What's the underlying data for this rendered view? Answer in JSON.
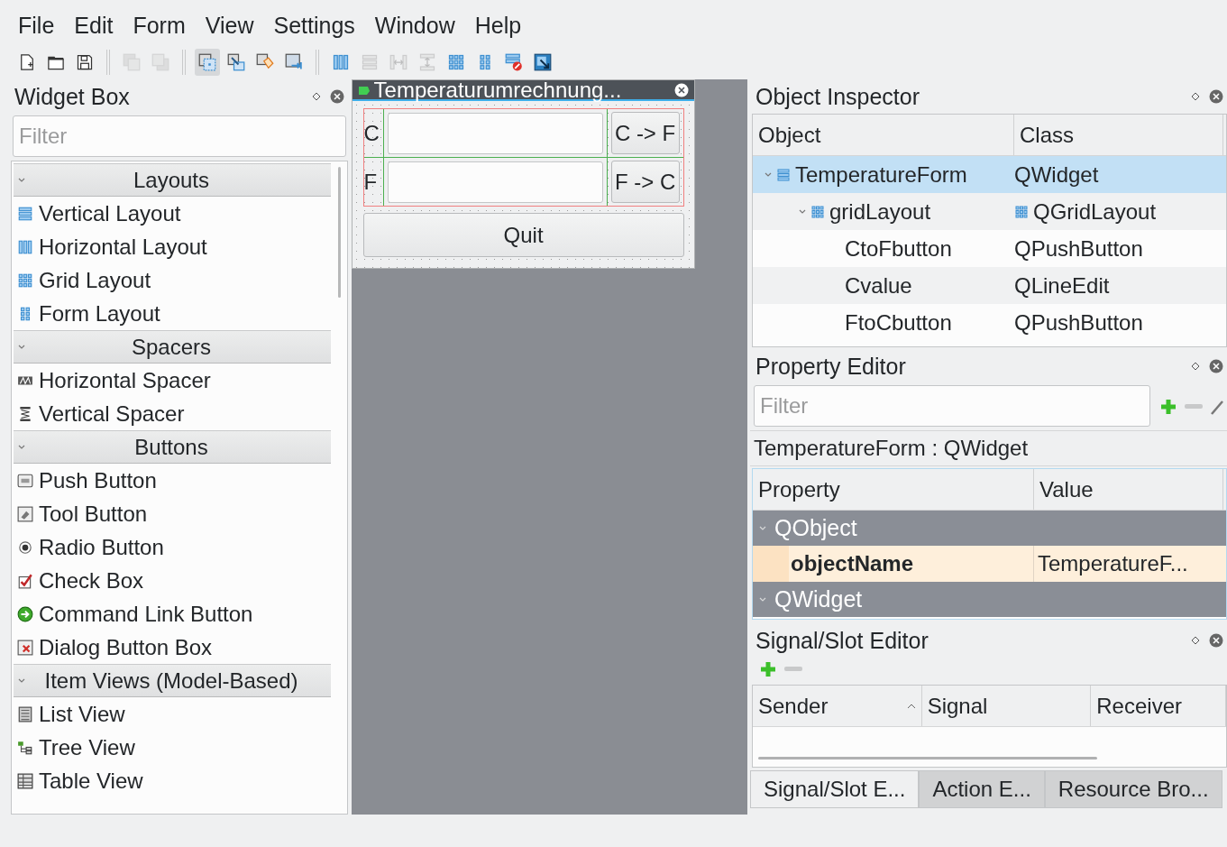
{
  "menu": [
    "File",
    "Edit",
    "Form",
    "View",
    "Settings",
    "Window",
    "Help"
  ],
  "toolbar": [
    {
      "kind": "new",
      "disabled": false,
      "selected": false
    },
    {
      "kind": "open",
      "disabled": false,
      "selected": false
    },
    {
      "kind": "save",
      "disabled": false,
      "selected": false
    },
    {
      "kind": "separator"
    },
    {
      "kind": "send-back",
      "disabled": true,
      "selected": false
    },
    {
      "kind": "bring-front",
      "disabled": true,
      "selected": false
    },
    {
      "kind": "separator"
    },
    {
      "kind": "edit-widgets",
      "disabled": false,
      "selected": true
    },
    {
      "kind": "edit-signals",
      "disabled": false,
      "selected": false
    },
    {
      "kind": "edit-buddies",
      "disabled": false,
      "selected": false
    },
    {
      "kind": "edit-tab-order",
      "disabled": false,
      "selected": false
    },
    {
      "kind": "separator"
    },
    {
      "kind": "layout-h",
      "disabled": false,
      "selected": false
    },
    {
      "kind": "layout-v",
      "disabled": true,
      "selected": false
    },
    {
      "kind": "split-h",
      "disabled": true,
      "selected": false
    },
    {
      "kind": "split-v",
      "disabled": true,
      "selected": false
    },
    {
      "kind": "grid",
      "disabled": false,
      "selected": false
    },
    {
      "kind": "form",
      "disabled": false,
      "selected": false
    },
    {
      "kind": "break",
      "disabled": false,
      "selected": false
    },
    {
      "kind": "adjust",
      "disabled": false,
      "selected": false
    }
  ],
  "widget_box": {
    "title": "Widget Box",
    "filter": {
      "placeholder": "Filter"
    },
    "categories": [
      {
        "label": "Layouts",
        "expanded": true,
        "items": [
          {
            "label": "Vertical Layout",
            "kind": "vertical-layout"
          },
          {
            "label": "Horizontal Layout",
            "kind": "horizontal-layout"
          },
          {
            "label": "Grid Layout",
            "kind": "grid-layout"
          },
          {
            "label": "Form Layout",
            "kind": "form-layout"
          }
        ]
      },
      {
        "label": "Spacers",
        "expanded": true,
        "items": [
          {
            "label": "Horizontal Spacer",
            "kind": "horizontal-spacer"
          },
          {
            "label": "Vertical Spacer",
            "kind": "vertical-spacer"
          }
        ]
      },
      {
        "label": "Buttons",
        "expanded": true,
        "items": [
          {
            "label": "Push Button",
            "kind": "push-button"
          },
          {
            "label": "Tool Button",
            "kind": "tool-button"
          },
          {
            "label": "Radio Button",
            "kind": "radio-button"
          },
          {
            "label": "Check Box",
            "kind": "check-box"
          },
          {
            "label": "Command Link Button",
            "kind": "command-link"
          },
          {
            "label": "Dialog Button Box",
            "kind": "dialog-button-box"
          }
        ]
      },
      {
        "label": "Item Views (Model-Based)",
        "expanded": true,
        "items": [
          {
            "label": "List View",
            "kind": "list-view"
          },
          {
            "label": "Tree View",
            "kind": "tree-view"
          },
          {
            "label": "Table View",
            "kind": "table-view"
          }
        ]
      }
    ]
  },
  "form_window": {
    "title": "Temperaturumrechnung...",
    "rows": [
      {
        "label": "C",
        "button": "C -> F"
      },
      {
        "label": "F",
        "button": "F -> C"
      }
    ],
    "quit": "Quit"
  },
  "object_inspector": {
    "title": "Object Inspector",
    "columns": [
      "Object",
      "Class"
    ],
    "tree": [
      {
        "object": "TemperatureForm",
        "class": "QWidget",
        "kind": "widget",
        "selected": true,
        "expanded": true,
        "children": [
          {
            "object": "gridLayout",
            "class": "QGridLayout",
            "kind": "layout",
            "selected": false,
            "expanded": true,
            "children": [
              {
                "object": "CtoFbutton",
                "class": "QPushButton",
                "selected": false
              },
              {
                "object": "Cvalue",
                "class": "QLineEdit",
                "selected": false
              },
              {
                "object": "FtoCbutton",
                "class": "QPushButton",
                "selected": false
              }
            ]
          }
        ]
      }
    ]
  },
  "property_editor": {
    "title": "Property Editor",
    "filter": {
      "placeholder": "Filter"
    },
    "object_label": "TemperatureForm : QWidget",
    "columns": [
      "Property",
      "Value"
    ],
    "groups": [
      {
        "name": "QObject",
        "expanded": true,
        "properties": [
          {
            "name": "objectName",
            "value": "TemperatureF...",
            "changed": true
          }
        ]
      },
      {
        "name": "QWidget",
        "expanded": true
      }
    ]
  },
  "signal_slot_editor": {
    "title": "Signal/Slot Editor",
    "columns": [
      {
        "label": "Sender",
        "sorted": true
      },
      {
        "label": "Signal",
        "sorted": false
      },
      {
        "label": "Receiver",
        "sorted": false
      }
    ]
  },
  "bottom_tabs": [
    {
      "label": "Signal/Slot E...",
      "selected": true
    },
    {
      "label": "Action E...",
      "selected": false
    },
    {
      "label": "Resource Bro...",
      "selected": false
    }
  ]
}
